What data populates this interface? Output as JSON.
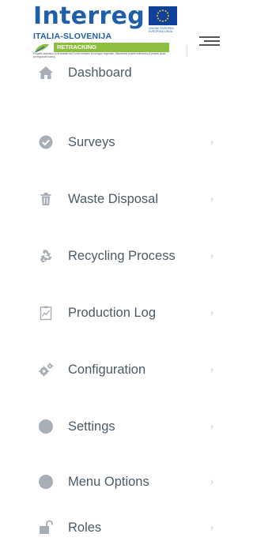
{
  "brand": {
    "name": "Interreg",
    "region": "ITALIA-SLOVENIJA",
    "project": "RETRACKING",
    "eu_text": "UNIONE EUROPEA EVROPSKA UNIJA",
    "fine_print": "Progetto standard co-finanziato dal Fondo europeo di sviluppo regionale. Standardni projekt sofinancira Evropski sklad za regionalni razvoj"
  },
  "menu": {
    "items": [
      {
        "label": "Dashboard",
        "icon": "home-icon"
      },
      {
        "label": "Surveys",
        "icon": "check-circle-icon"
      },
      {
        "label": "Waste Disposal",
        "icon": "trash-icon"
      },
      {
        "label": "Recycling Process",
        "icon": "recycle-icon"
      },
      {
        "label": "Production Log",
        "icon": "clipboard-chart-icon"
      },
      {
        "label": "Configuration",
        "icon": "gears-icon"
      },
      {
        "label": "Settings",
        "icon": "circle-icon"
      },
      {
        "label": "Menu Options",
        "icon": "circle-icon"
      },
      {
        "label": "Roles",
        "icon": "unlock-icon"
      }
    ],
    "chevron": "›"
  },
  "colors": {
    "brand_blue": "#1f5ea8",
    "brand_green": "#8cbf3f",
    "menu_text": "#4b5a66",
    "icon_gray": "#a7aeb5"
  }
}
